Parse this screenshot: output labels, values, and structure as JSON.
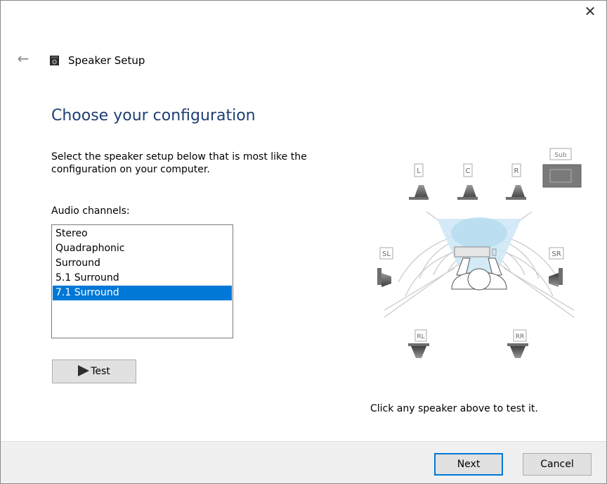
{
  "window": {
    "title": "Speaker Setup",
    "close_icon": "close-icon",
    "back_icon": "back-arrow-icon",
    "app_icon": "speaker-icon"
  },
  "page": {
    "heading": "Choose your configuration",
    "instruction": "Select the speaker setup below that is most like the configuration on your computer.",
    "channels_label": "Audio channels:",
    "channels": [
      "Stereo",
      "Quadraphonic",
      "Surround",
      "5.1 Surround",
      "7.1 Surround"
    ],
    "selected_channel": "7.1 Surround",
    "test_label": "Test",
    "hint": "Click any speaker above to test it."
  },
  "speakers": {
    "sub": "Sub",
    "left": "L",
    "center": "C",
    "right": "R",
    "side_left": "SL",
    "side_right": "SR",
    "rear_left": "RL",
    "rear_right": "RR"
  },
  "footer": {
    "next_label": "Next",
    "cancel_label": "Cancel"
  },
  "colors": {
    "heading": "#1e3f73",
    "selection": "#0078d7",
    "footer_bg": "#f0f0f0"
  }
}
